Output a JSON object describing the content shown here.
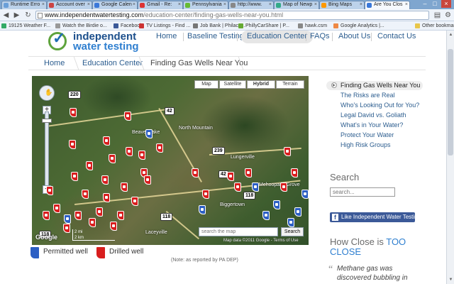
{
  "browser": {
    "tabs": [
      {
        "label": "Runtime Erro",
        "color": "#6a9fd8"
      },
      {
        "label": "Account over",
        "color": "#c44"
      },
      {
        "label": "Google Calen",
        "color": "#3a78d9"
      },
      {
        "label": "Gmail - Re:",
        "color": "#d33"
      },
      {
        "label": "Pennsylvania",
        "color": "#6b3"
      },
      {
        "label": "http://www.",
        "color": "#888"
      },
      {
        "label": "Map of Newp",
        "color": "#3a8"
      },
      {
        "label": "Bing Maps",
        "color": "#f90"
      },
      {
        "label": "Are You Clos",
        "color": "#3a78d9",
        "active": true
      }
    ],
    "url_domain": "www.independentwatertesting.com",
    "url_path": "/education-center/finding-gas-wells-near-you.html",
    "bookmarks": [
      {
        "label": "19125 Weather F...",
        "color": "#3a6"
      },
      {
        "label": "Watch the Birdie o...",
        "color": "#999"
      },
      {
        "label": "Facebook",
        "color": "#3b5998"
      },
      {
        "label": "TV Listings - Find ...",
        "color": "#c33"
      },
      {
        "label": "Job Bank | Philacu...",
        "color": "#777"
      },
      {
        "label": "PhillyCarShare | P...",
        "color": "#6a3"
      },
      {
        "label": "hawk.csm",
        "color": "#888"
      },
      {
        "label": "Google Analytics |...",
        "color": "#e84"
      },
      {
        "label": "Other bookmarks",
        "color": "#e8c64a"
      }
    ]
  },
  "site": {
    "logo_line1": "independent",
    "logo_line2": "water testing",
    "nav": [
      "Home",
      "Baseline Testing",
      "Education Center",
      "FAQs",
      "About Us",
      "Contact Us"
    ],
    "active_nav": "Education Center",
    "breadcrumbs": [
      "Home",
      "Education Center",
      "Finding Gas Wells Near You"
    ]
  },
  "map": {
    "type_buttons": [
      "Map",
      "Satellite",
      "Hybrid",
      "Terrain"
    ],
    "active_type": "Hybrid",
    "route_shields": [
      "220",
      "42",
      "239",
      "42",
      "118",
      "118",
      "118"
    ],
    "towns": [
      "Beaver Lake",
      "North Mountain",
      "Lungerville",
      "Biggertown",
      "Mehoopany Grove",
      "Laceyville"
    ],
    "search_placeholder": "search the map",
    "search_button": "Search",
    "google_logo": "Google",
    "scale": [
      "2 mi",
      "2 km"
    ],
    "attribution": "Map data ©2011 Google - Terms of Use"
  },
  "legend": {
    "permitted": "Permitted well",
    "drilled": "Drilled well",
    "note": "(Note: as reported by PA DEP)"
  },
  "sidebar": {
    "links": [
      "Finding Gas Wells Near You",
      "The Risks are Real",
      "Who's Looking Out for You?",
      "Legal David vs. Goliath",
      "What's in Your Water?",
      "Protect Your Water",
      "High Risk Groups"
    ],
    "search_heading": "Search",
    "search_placeholder": "search...",
    "facebook_like": "Like Independent Water Testing",
    "how_close_heading_a": "How Close is ",
    "how_close_heading_b": "TOO CLOSE",
    "quote": "Methane gas was discovered bubbling in"
  },
  "colors": {
    "brand_dark": "#1c4f8c",
    "brand_light": "#2f7fd0",
    "logo_ring": "#5ea33c",
    "drilled_pin": "#d81e1e",
    "permitted_pin": "#2c5fc4",
    "link": "#2c5d8f"
  }
}
